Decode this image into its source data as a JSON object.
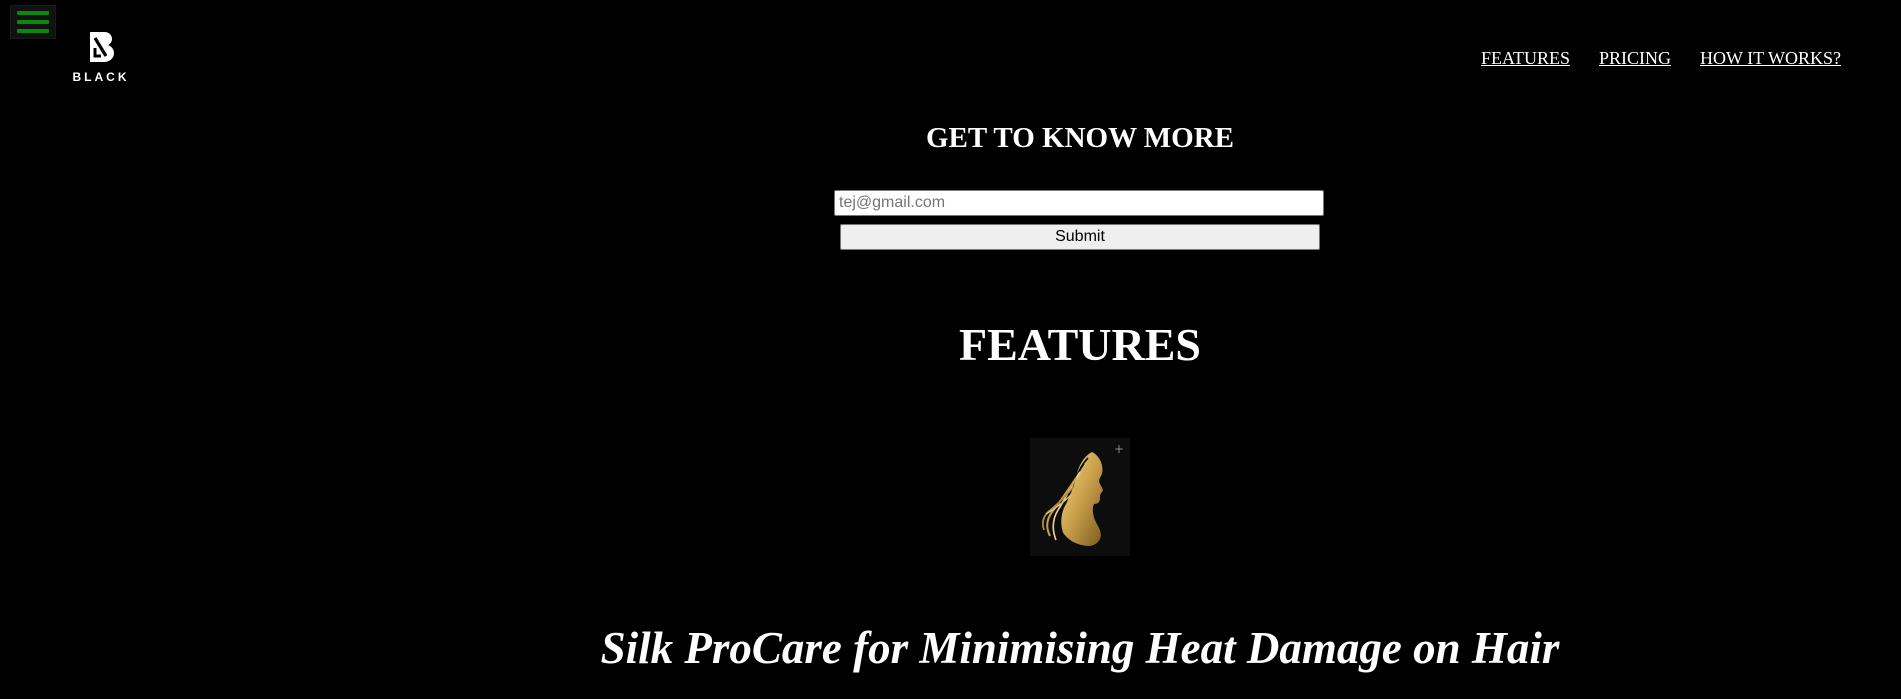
{
  "header": {
    "menu_icon": "hamburger-menu-icon",
    "menu_color": "#0a8a0a",
    "logo": {
      "icon": "b-monogram-logo",
      "text": "BLACK"
    },
    "nav": [
      {
        "label": "FEATURES"
      },
      {
        "label": "PRICING"
      },
      {
        "label": "HOW IT WORKS?"
      }
    ]
  },
  "signup": {
    "heading": "GET TO KNOW MORE",
    "email_placeholder": "tej@gmail.com",
    "submit_label": "Submit"
  },
  "features": {
    "heading": "FEATURES",
    "image_icon": "golden-hair-silhouette-image",
    "items": [
      {
        "title": "Silk ProCare for Minimising Heat Damage on Hair"
      }
    ]
  },
  "colors": {
    "background": "#000000",
    "text": "#ffffff",
    "accent_gold": "#c9a04a"
  }
}
